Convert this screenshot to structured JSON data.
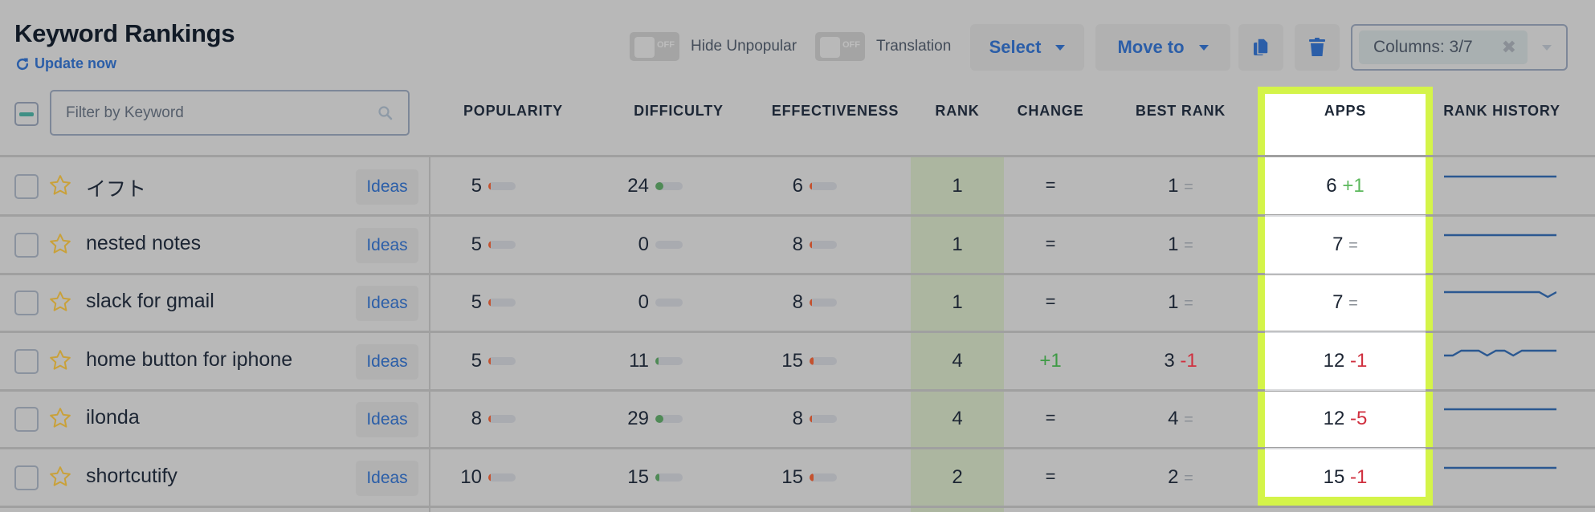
{
  "header": {
    "title": "Keyword Rankings",
    "update_label": "Update now",
    "filter_placeholder": "Filter by Keyword"
  },
  "toolbar": {
    "toggles": [
      {
        "label": "Hide Unpopular",
        "state": "OFF"
      },
      {
        "label": "Translation",
        "state": "OFF"
      }
    ],
    "select_label": "Select",
    "move_label": "Move to",
    "columns_label": "Columns: 3/7"
  },
  "columns": [
    "POPULARITY",
    "DIFFICULTY",
    "EFFECTIVENESS",
    "RANK",
    "CHANGE",
    "BEST RANK",
    "APPS",
    "RANK HISTORY"
  ],
  "colors": {
    "accent": "#2b5ea8",
    "highlight": "#d4f449",
    "positive": "#3e9a45",
    "negative": "#d0303f",
    "popularity_bar": "#c4522f",
    "difficulty_bar": "#4f8a56"
  },
  "rows": [
    {
      "keyword": "イフト",
      "ideas": "Ideas",
      "popularity": "5",
      "pop_frac": 0.05,
      "difficulty": "24",
      "diff_frac": 0.24,
      "effectiveness": "6",
      "eff_frac": 0.06,
      "rank": "1",
      "change": "=",
      "change_type": "eq",
      "best_rank": "1",
      "best_delta": "=",
      "best_type": "eq",
      "apps": "6",
      "apps_delta": "+1",
      "apps_type": "pos",
      "history": [
        1,
        1,
        1,
        1,
        1,
        1,
        1,
        1,
        1,
        1,
        1,
        1,
        1,
        1
      ]
    },
    {
      "keyword": "nested notes",
      "ideas": "Ideas",
      "popularity": "5",
      "pop_frac": 0.05,
      "difficulty": "0",
      "diff_frac": 0,
      "effectiveness": "8",
      "eff_frac": 0.08,
      "rank": "1",
      "change": "=",
      "change_type": "eq",
      "best_rank": "1",
      "best_delta": "=",
      "best_type": "eq",
      "apps": "7",
      "apps_delta": "=",
      "apps_type": "eq",
      "history": [
        1,
        1,
        1,
        1,
        1,
        1,
        1,
        1,
        1,
        1,
        1,
        1,
        1,
        1
      ]
    },
    {
      "keyword": "slack for gmail",
      "ideas": "Ideas",
      "popularity": "5",
      "pop_frac": 0.05,
      "difficulty": "0",
      "diff_frac": 0,
      "effectiveness": "8",
      "eff_frac": 0.08,
      "rank": "1",
      "change": "=",
      "change_type": "eq",
      "best_rank": "1",
      "best_delta": "=",
      "best_type": "eq",
      "apps": "7",
      "apps_delta": "=",
      "apps_type": "eq",
      "history": [
        1,
        1,
        1,
        1,
        1,
        1,
        1,
        1,
        1,
        1,
        1,
        1,
        2,
        1
      ]
    },
    {
      "keyword": "home button for iphone",
      "ideas": "Ideas",
      "popularity": "5",
      "pop_frac": 0.05,
      "difficulty": "11",
      "diff_frac": 0.11,
      "effectiveness": "15",
      "eff_frac": 0.15,
      "rank": "4",
      "change": "+1",
      "change_type": "pos",
      "best_rank": "3",
      "best_delta": "-1",
      "best_type": "neg",
      "apps": "12",
      "apps_delta": "-1",
      "apps_type": "neg",
      "history": [
        5,
        5,
        4,
        4,
        4,
        5,
        4,
        4,
        5,
        4,
        4,
        4,
        4,
        4
      ]
    },
    {
      "keyword": "ilonda",
      "ideas": "Ideas",
      "popularity": "8",
      "pop_frac": 0.08,
      "difficulty": "29",
      "diff_frac": 0.29,
      "effectiveness": "8",
      "eff_frac": 0.08,
      "rank": "4",
      "change": "=",
      "change_type": "eq",
      "best_rank": "4",
      "best_delta": "=",
      "best_type": "eq",
      "apps": "12",
      "apps_delta": "-5",
      "apps_type": "neg",
      "history": [
        4,
        4,
        4,
        4,
        4,
        4,
        4,
        4,
        4,
        4,
        4,
        4,
        4,
        4
      ]
    },
    {
      "keyword": "shortcutify",
      "ideas": "Ideas",
      "popularity": "10",
      "pop_frac": 0.1,
      "difficulty": "15",
      "diff_frac": 0.15,
      "effectiveness": "15",
      "eff_frac": 0.15,
      "rank": "2",
      "change": "=",
      "change_type": "eq",
      "best_rank": "2",
      "best_delta": "=",
      "best_type": "eq",
      "apps": "15",
      "apps_delta": "-1",
      "apps_type": "neg",
      "history": [
        2,
        2,
        2,
        2,
        2,
        2,
        2,
        2,
        2,
        2,
        2,
        2,
        2,
        2
      ]
    }
  ]
}
